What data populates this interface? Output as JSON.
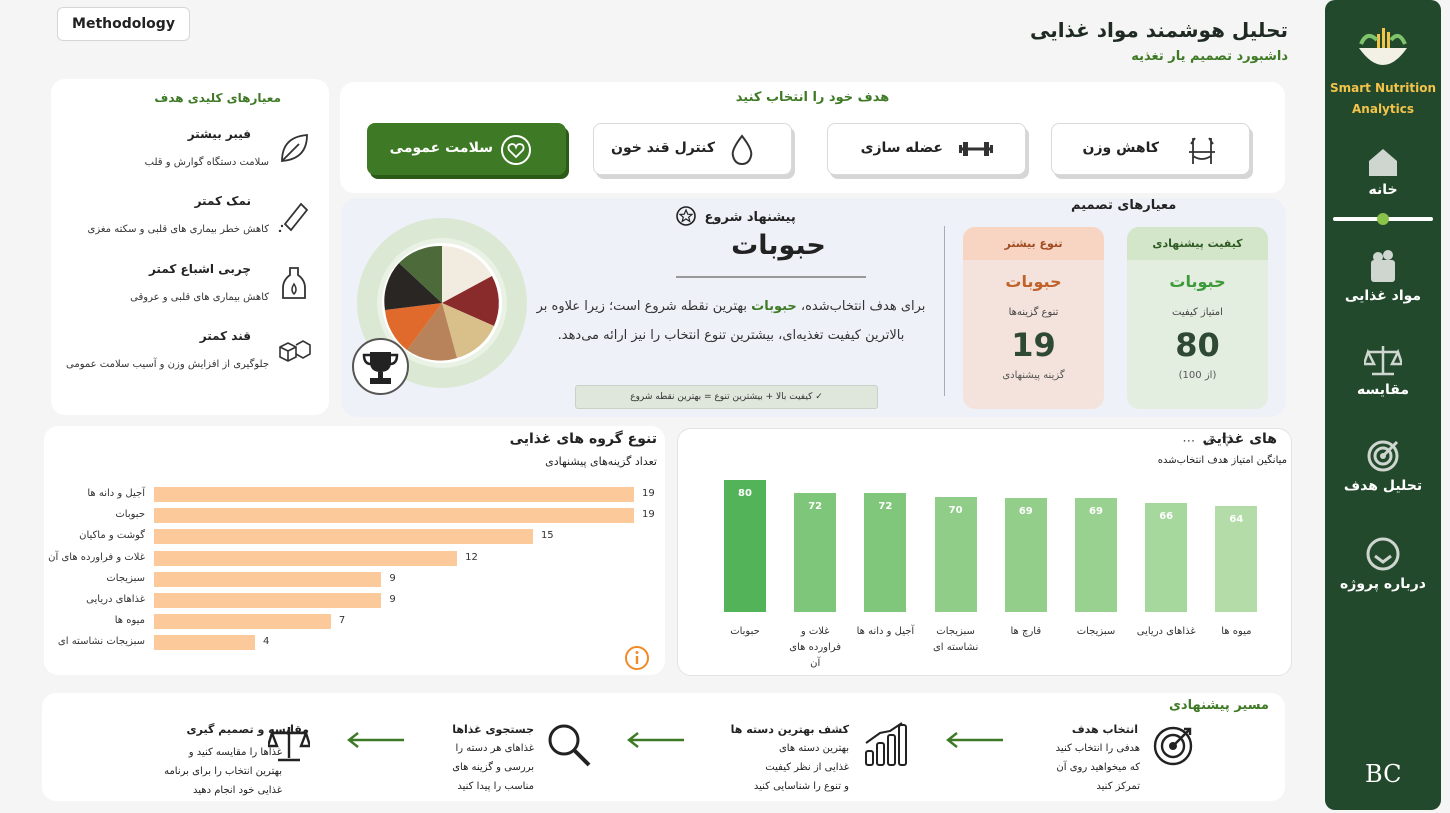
{
  "header": {
    "title": "تحلیل هوشمند مواد غذایی",
    "subtitle": "داشبورد تصمیم یار تغذیه",
    "methodology_label": "Methodology"
  },
  "sidebar": {
    "brand_line1": "Smart Nutrition",
    "brand_line2": "Analytics",
    "items": [
      {
        "label": "خانه",
        "icon": "home-icon",
        "active": true
      },
      {
        "label": "مواد غذایی",
        "icon": "grocery-bag-icon"
      },
      {
        "label": "مقایسه",
        "icon": "scale-icon"
      },
      {
        "label": "تحلیل هدف",
        "icon": "target-icon"
      },
      {
        "label": "درباره پروژه",
        "icon": "info-bubble-icon"
      }
    ],
    "signature": "BC"
  },
  "criteria": {
    "title": "معیارهای کلیدی هدف",
    "items": [
      {
        "title": "فیبر بیشتر",
        "desc": "سلامت دستگاه گوارش و قلب",
        "icon": "leaf-icon"
      },
      {
        "title": "نمک کمتر",
        "desc": "کاهش خطر بیماری های قلبی و سکته مغزی",
        "icon": "salt-shaker-icon"
      },
      {
        "title": "چربی اشباع کمتر",
        "desc": "کاهش بیماری های قلبی و عروقی",
        "icon": "oil-bottle-icon"
      },
      {
        "title": "قند کمتر",
        "desc": "جلوگیری از افزایش وزن و آسیب سلامت عمومی",
        "icon": "sugar-cubes-icon"
      }
    ]
  },
  "goals": {
    "title": "هدف خود را انتخاب کنید",
    "buttons": [
      {
        "label": "کاهش وزن",
        "icon": "measure-icon"
      },
      {
        "label": "عضله سازی",
        "icon": "dumbbell-icon"
      },
      {
        "label": "کنترل قند خون",
        "icon": "drop-icon"
      },
      {
        "label": "سلامت عمومی",
        "icon": "heart-icon",
        "active": true
      }
    ]
  },
  "recommendation": {
    "start_label": "پیشنهاد شروع",
    "food": "حبوبات",
    "desc_before": "برای هدف انتخاب‌شده، ",
    "desc_highlight": "حبوبات",
    "desc_after": " بهترین نقطه شروع است؛ زیرا علاوه بر بالاترین کیفیت تغذیه‌ای، بیشترین تنوع انتخاب را نیز ارائه می‌دهد.",
    "badge": "✓  کیفیت بالا + بیشترین تنوع = بهترین نقطه شروع"
  },
  "decision": {
    "title": "معیارهای تصمیم",
    "quality": {
      "header": "کیفیت پیشنهادی",
      "food": "حبوبات",
      "label": "امتیاز کیفیت",
      "value": "80",
      "sub": "(از 100)"
    },
    "variety": {
      "header": "تنوع بیشتر",
      "food": "حبوبات",
      "label": "تنوع گزینه‌ها",
      "value": "19",
      "sub": "گزینه پیشنهادی"
    }
  },
  "variety_chart": {
    "title": "تنوع گروه های غذایی",
    "subtitle": "تعداد گزینه‌های پیشنهادی"
  },
  "groups_chart": {
    "title": "های غذایی",
    "subtitle": "میانگین امتیاز هدف انتخاب‌شده"
  },
  "chart_data": [
    {
      "type": "bar",
      "orientation": "horizontal",
      "title": "تنوع گروه های غذایی",
      "subtitle": "تعداد گزینه‌های پیشنهادی",
      "categories": [
        "آجیل و دانه ها",
        "حبوبات",
        "گوشت و ماکیان",
        "غلات و فراورده های آن",
        "سبزیجات",
        "غذاهای دریایی",
        "میوه ها",
        "سبزیجات نشاسته ای"
      ],
      "values": [
        19,
        19,
        15,
        12,
        9,
        9,
        7,
        4
      ],
      "xlim": [
        0,
        19
      ],
      "grid": false,
      "color": "#fcc99a"
    },
    {
      "type": "bar",
      "orientation": "vertical",
      "title": "های غذایی",
      "subtitle": "میانگین امتیاز هدف انتخاب‌شده",
      "categories": [
        "حبوبات",
        "غلات و فراورده های آن",
        "آجیل و دانه ها",
        "سبزیجات نشاسته ای",
        "قارچ ها",
        "سبزیجات",
        "غذاهای دریایی",
        "میوه ها"
      ],
      "values": [
        80,
        72,
        72,
        70,
        69,
        69,
        66,
        64
      ],
      "ylim": [
        0,
        80
      ],
      "grid": false,
      "colors": [
        "#52b359",
        "#7ec67a",
        "#80c77c",
        "#8fcd88",
        "#93cf8b",
        "#99d190",
        "#a6d79c",
        "#b3dca9"
      ]
    }
  ],
  "path": {
    "title": "مسیر پیشنهادی",
    "steps": [
      {
        "title": "انتخاب هدف",
        "desc": [
          "هدفی را انتخاب کنید",
          "که میخواهید روی آن",
          "تمرکز کنید"
        ],
        "icon": "target-icon"
      },
      {
        "title": "کشف بهترین دسته ها",
        "desc": [
          "بهترین دسته های",
          "غذایی از نظر کیفیت",
          "و تنوع را شناسایی کنید"
        ],
        "icon": "bar-chart-icon"
      },
      {
        "title": "جستجوی غذاها",
        "desc": [
          "غذاهای هر دسته را",
          "بررسی و گزینه های",
          "مناسب را پیدا کنید"
        ],
        "icon": "search-icon"
      },
      {
        "title": "مقایسه و تصمیم گیری",
        "desc": [
          "غذاها را مقایسه کنید و",
          "بهترین انتخاب را برای برنامه",
          "غذایی خود انجام دهید"
        ],
        "icon": "scale-icon"
      }
    ]
  }
}
